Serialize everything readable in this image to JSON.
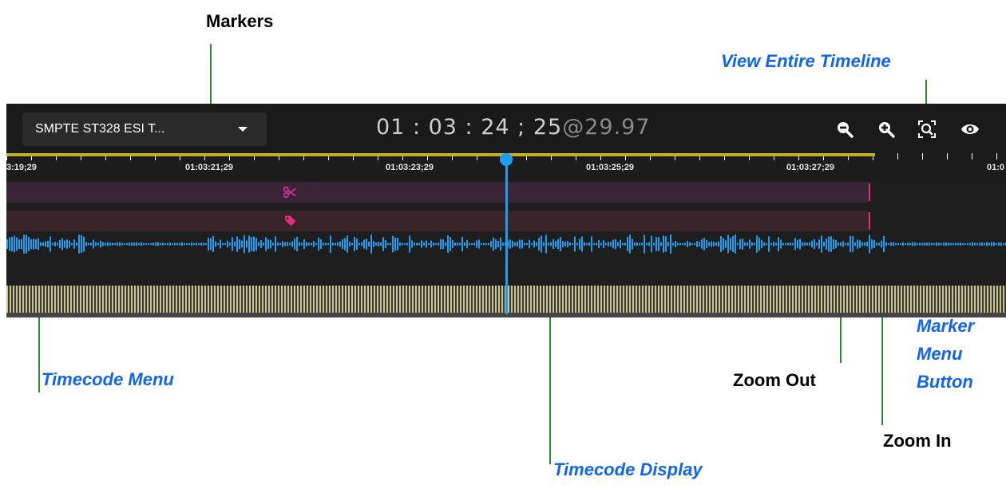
{
  "callouts": {
    "markers": "Markers",
    "view_entire_timeline": "View Entire Timeline",
    "timecode_menu": "Timecode Menu",
    "zoom_out": "Zoom Out",
    "zoom_in": "Zoom In",
    "marker_menu_button": [
      "Marker",
      "Menu",
      "Button"
    ],
    "timecode_display": "Timecode Display"
  },
  "toolbar": {
    "timecode_menu_value": "SMPTE ST328 ESI T...",
    "timecode": "01 : 03 : 24 ; 25",
    "frame_rate": "@29.97"
  },
  "ruler": {
    "labels": [
      "3:19;29",
      "01:03:21;29",
      "01:03:23;29",
      "01:03:25;29",
      "01:03:27;29",
      "01:0"
    ]
  },
  "icons": {
    "edit_marker": "scissors-icon",
    "tag_marker": "tag-icon",
    "zoom_out": "zoom-out-icon",
    "zoom_in": "zoom-in-icon",
    "view_entire": "fit-timeline-icon",
    "marker_menu": "eye-icon"
  },
  "colors": {
    "waveform": "#1e9ef0",
    "playhead": "#1e9ef0",
    "ruler_band": "#bdb327",
    "marker": "#e0307a",
    "callout_blue": "#1066e8",
    "leader_green": "#2f8a2f"
  }
}
